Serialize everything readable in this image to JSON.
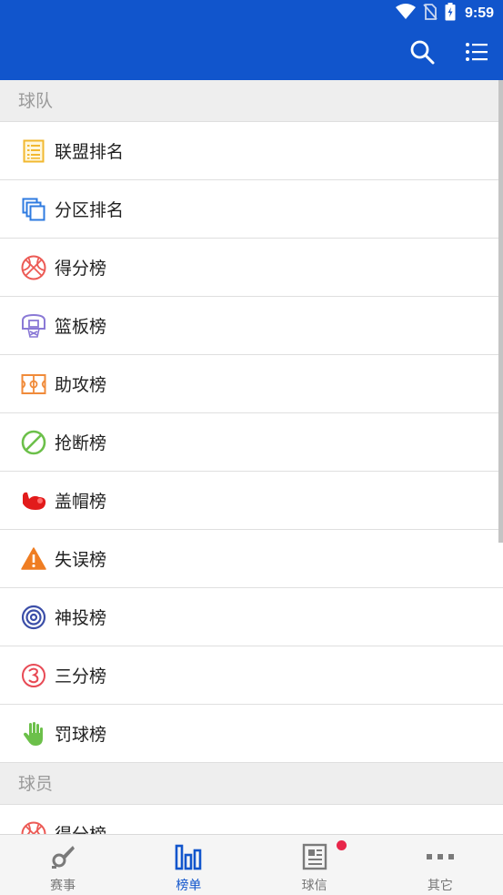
{
  "status": {
    "time": "9:59"
  },
  "appbar": {
    "icons": [
      "search-icon",
      "list-menu-icon"
    ]
  },
  "sections": [
    {
      "title": "球队",
      "items": [
        {
          "label": "联盟排名",
          "icon": "standings-list-icon"
        },
        {
          "label": "分区排名",
          "icon": "stacked-squares-icon"
        },
        {
          "label": "得分榜",
          "icon": "basketball-icon"
        },
        {
          "label": "篮板榜",
          "icon": "basketball-hoop-icon"
        },
        {
          "label": "助攻榜",
          "icon": "court-icon"
        },
        {
          "label": "抢断榜",
          "icon": "no-entry-icon"
        },
        {
          "label": "盖帽榜",
          "icon": "muscle-arm-icon"
        },
        {
          "label": "失误榜",
          "icon": "warning-icon"
        },
        {
          "label": "神投榜",
          "icon": "target-icon"
        },
        {
          "label": "三分榜",
          "icon": "number-three-icon"
        },
        {
          "label": "罚球榜",
          "icon": "hand-icon"
        }
      ]
    },
    {
      "title": "球员",
      "items": [
        {
          "label": "得分榜",
          "icon": "basketball-icon"
        }
      ]
    }
  ],
  "bottom_nav": [
    {
      "label": "赛事",
      "icon": "whistle-icon",
      "active": false
    },
    {
      "label": "榜单",
      "icon": "bar-ranking-icon",
      "active": true
    },
    {
      "label": "球信",
      "icon": "news-icon",
      "active": false,
      "badge": true
    },
    {
      "label": "其它",
      "icon": "more-dots-icon",
      "active": false
    }
  ],
  "colors": {
    "primary": "#1155cc",
    "badge": "#e8264a"
  }
}
